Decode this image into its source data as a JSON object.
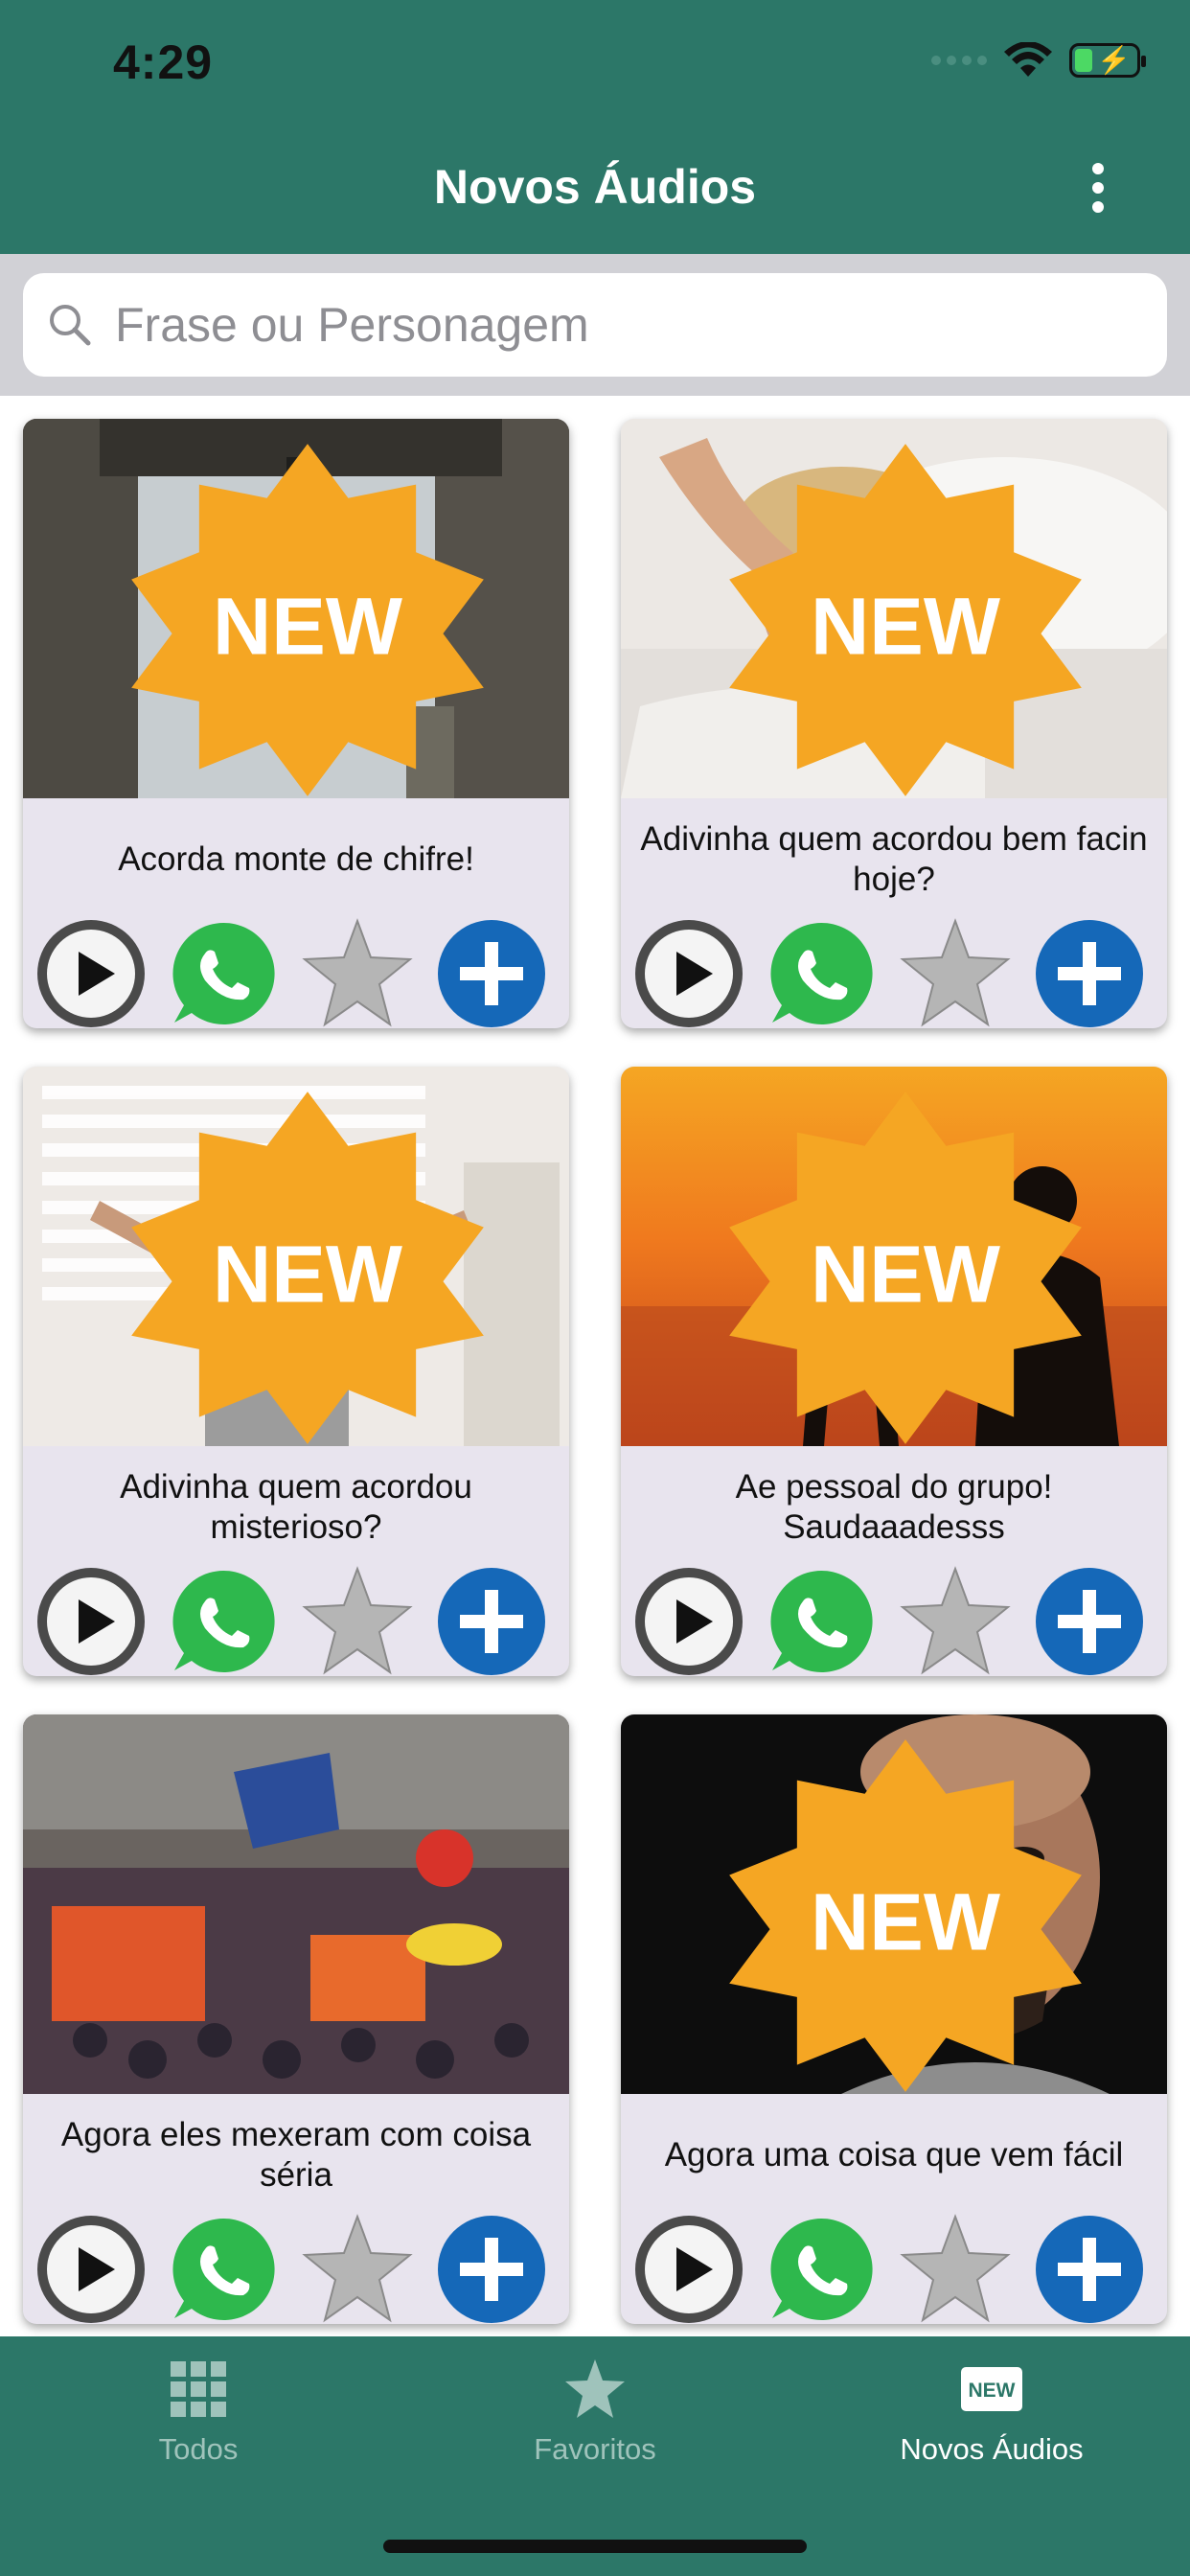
{
  "status_bar": {
    "time": "4:29"
  },
  "header": {
    "title": "Novos Áudios",
    "menu_icon": "more-vertical-icon"
  },
  "search": {
    "placeholder": "Frase ou Personagem",
    "value": ""
  },
  "badge_label": "NEW",
  "cards": [
    {
      "title": "Acorda monte de chifre!",
      "new": true,
      "image": "church-bell-photo"
    },
    {
      "title": "Adivinha quem acordou bem facin hoje?",
      "new": true,
      "image": "woman-waking-photo"
    },
    {
      "title": "Adivinha quem acordou misterioso?",
      "new": true,
      "image": "man-stretching-photo"
    },
    {
      "title": "Ae pessoal do grupo! Saudaaadesss",
      "new": true,
      "image": "sunset-silhouette-photo"
    },
    {
      "title": "Agora eles mexeram com coisa séria",
      "new": false,
      "image": "crowd-protest-photo"
    },
    {
      "title": "Agora uma coisa que vem fácil",
      "new": true,
      "image": "angry-man-photo"
    }
  ],
  "card_actions": [
    "play-icon",
    "whatsapp-icon",
    "star-icon",
    "plus-icon"
  ],
  "tabbar": {
    "tabs": [
      {
        "label": "Todos",
        "icon": "grid-icon",
        "active": false
      },
      {
        "label": "Favoritos",
        "icon": "star-icon",
        "active": false
      },
      {
        "label": "Novos Áudios",
        "icon": "new-badge-icon",
        "active": true
      }
    ]
  },
  "colors": {
    "primary": "#2c7768",
    "card_bg": "#e8e4ee",
    "inactive_tab": "#9fc3bb"
  }
}
